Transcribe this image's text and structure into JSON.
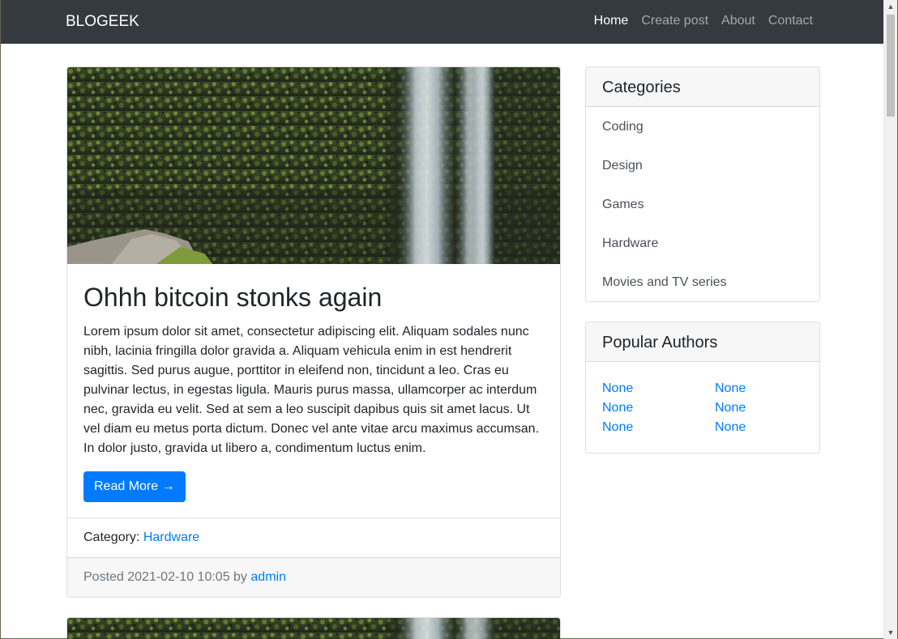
{
  "navbar": {
    "brand": "BLOGEEK",
    "links": [
      {
        "label": "Home",
        "active": true
      },
      {
        "label": "Create post",
        "active": false
      },
      {
        "label": "About",
        "active": false
      },
      {
        "label": "Contact",
        "active": false
      }
    ]
  },
  "post": {
    "image_description": "waterfall-over-mossy-cliff",
    "title": "Ohhh bitcoin stonks again",
    "body": "Lorem ipsum dolor sit amet, consectetur adipiscing elit. Aliquam sodales nunc nibh, lacinia fringilla dolor gravida a. Aliquam vehicula enim in est hendrerit sagittis. Sed purus augue, porttitor in eleifend non, tincidunt a leo. Cras eu pulvinar lectus, in egestas ligula. Mauris purus massa, ullamcorper ac interdum nec, gravida eu velit. Sed at sem a leo suscipit dapibus quis sit amet lacus. Ut vel diam eu metus porta dictum. Donec vel ante vitae arcu maximus accumsan. In dolor justo, gravida ut libero a, condimentum luctus enim.",
    "read_more_label": "Read More →",
    "category_prefix": "Category:",
    "category": "Hardware",
    "posted_prefix": "Posted 2021-02-10 10:05 by",
    "author": "admin"
  },
  "categories": {
    "title": "Categories",
    "items": [
      "Coding",
      "Design",
      "Games",
      "Hardware",
      "Movies and TV series"
    ]
  },
  "popular_authors": {
    "title": "Popular Authors",
    "items": [
      "None",
      "None",
      "None",
      "None",
      "None",
      "None"
    ]
  },
  "colors": {
    "navbar_bg": "#343a40",
    "primary": "#007bff",
    "link": "#007bff"
  },
  "icons": {
    "scroll_up": "triangle-up-icon",
    "scroll_down": "triangle-down-icon"
  }
}
